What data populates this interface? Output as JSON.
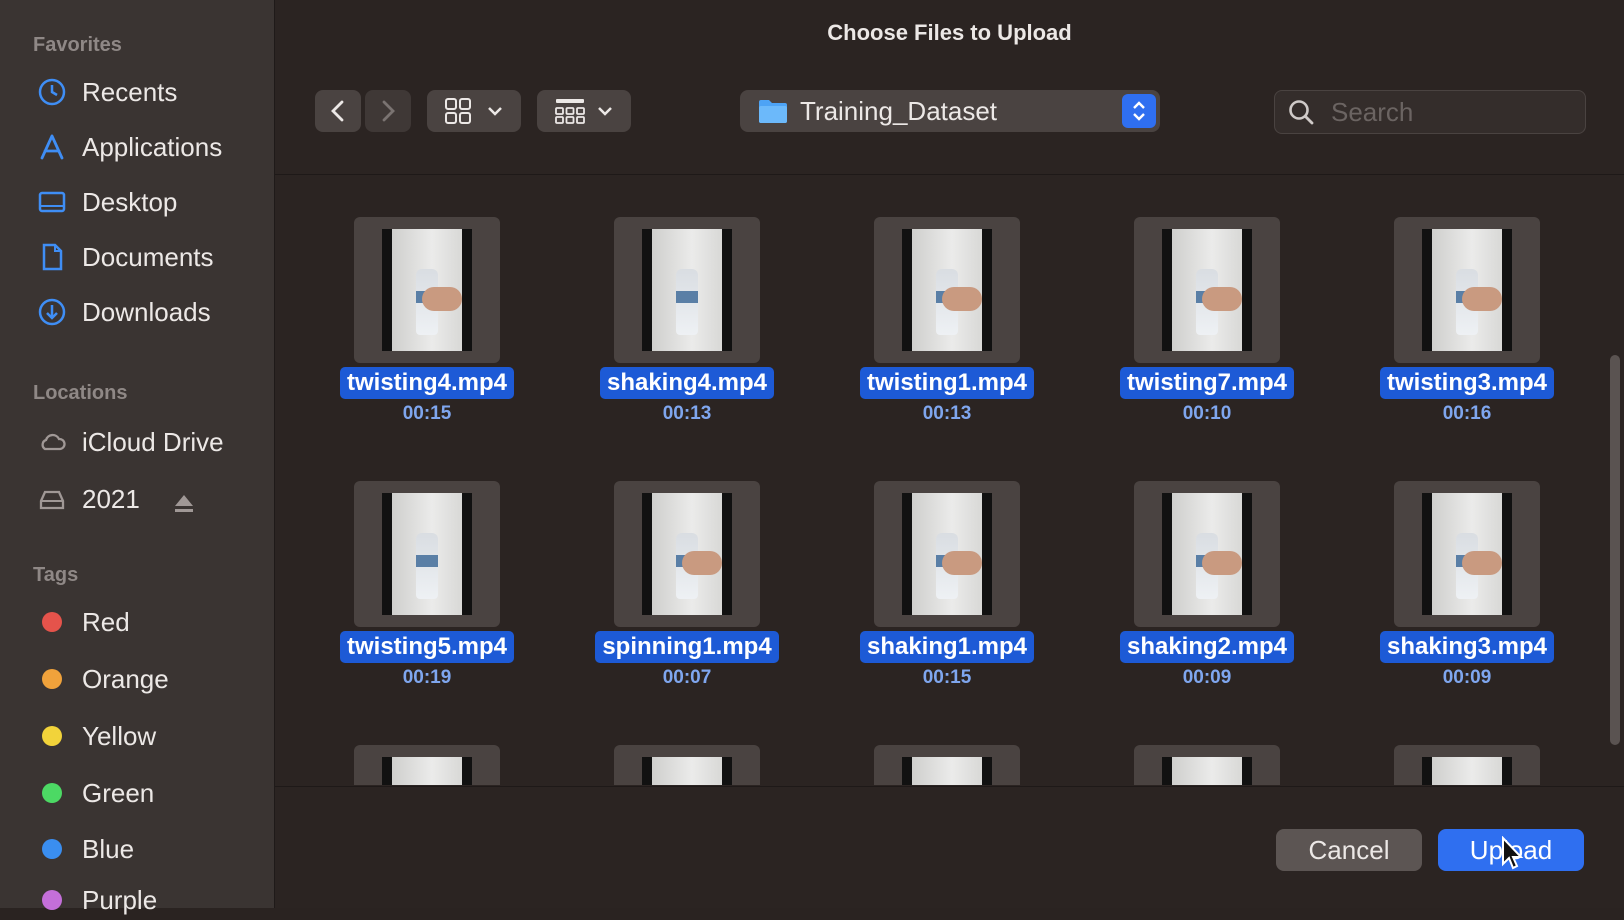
{
  "dialog": {
    "title": "Choose Files to Upload"
  },
  "sidebar": {
    "favorites_header": "Favorites",
    "favorites": [
      {
        "label": "Recents",
        "icon": "clock-icon"
      },
      {
        "label": "Applications",
        "icon": "applications-icon"
      },
      {
        "label": "Desktop",
        "icon": "desktop-icon"
      },
      {
        "label": "Documents",
        "icon": "document-icon"
      },
      {
        "label": "Downloads",
        "icon": "download-icon"
      }
    ],
    "locations_header": "Locations",
    "locations": [
      {
        "label": "iCloud Drive",
        "icon": "cloud-icon"
      },
      {
        "label": "2021",
        "icon": "drive-icon"
      }
    ],
    "tags_header": "Tags",
    "tags": [
      {
        "label": "Red",
        "color": "#e5534b"
      },
      {
        "label": "Orange",
        "color": "#f0a23b"
      },
      {
        "label": "Yellow",
        "color": "#f2d33a"
      },
      {
        "label": "Green",
        "color": "#4cd964"
      },
      {
        "label": "Blue",
        "color": "#3a8ef0"
      },
      {
        "label": "Purple",
        "color": "#c46fd9"
      }
    ]
  },
  "toolbar": {
    "current_folder": "Training_Dataset",
    "search_placeholder": "Search"
  },
  "files": [
    {
      "name": "twisting4.mp4",
      "duration": "00:15"
    },
    {
      "name": "shaking4.mp4",
      "duration": "00:13"
    },
    {
      "name": "twisting1.mp4",
      "duration": "00:13"
    },
    {
      "name": "twisting7.mp4",
      "duration": "00:10"
    },
    {
      "name": "twisting3.mp4",
      "duration": "00:16"
    },
    {
      "name": "twisting5.mp4",
      "duration": "00:19"
    },
    {
      "name": "spinning1.mp4",
      "duration": "00:07"
    },
    {
      "name": "shaking1.mp4",
      "duration": "00:15"
    },
    {
      "name": "shaking2.mp4",
      "duration": "00:09"
    },
    {
      "name": "shaking3.mp4",
      "duration": "00:09"
    }
  ],
  "buttons": {
    "cancel": "Cancel",
    "upload": "Upload"
  },
  "colors": {
    "accent": "#2f6ff0",
    "selection": "#1d5ad6"
  }
}
